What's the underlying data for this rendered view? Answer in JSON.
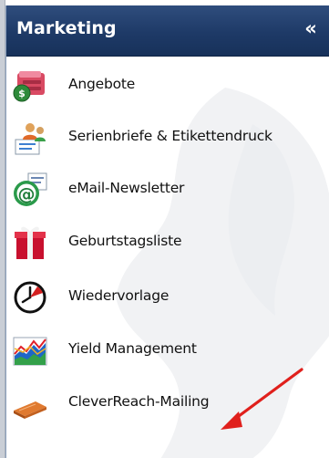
{
  "panel": {
    "title": "Marketing",
    "collapse_glyph": "«"
  },
  "menu": {
    "items": [
      {
        "label": "Angebote",
        "icon": "offers-icon"
      },
      {
        "label": "Serienbriefe & Etikettendruck",
        "icon": "mail-merge-icon"
      },
      {
        "label": "eMail-Newsletter",
        "icon": "email-newsletter-icon"
      },
      {
        "label": "Geburtstagsliste",
        "icon": "gift-icon"
      },
      {
        "label": "Wiedervorlage",
        "icon": "clock-icon"
      },
      {
        "label": "Yield Management",
        "icon": "chart-icon"
      },
      {
        "label": "CleverReach-Mailing",
        "icon": "cleverreach-icon"
      }
    ]
  },
  "annotation": {
    "arrow_color": "#e0201c",
    "target": "CleverReach-Mailing"
  },
  "colors": {
    "header_bg": "#1e3a67",
    "header_text": "#ffffff",
    "panel_border": "#8fa3bf",
    "label_text": "#111111"
  }
}
